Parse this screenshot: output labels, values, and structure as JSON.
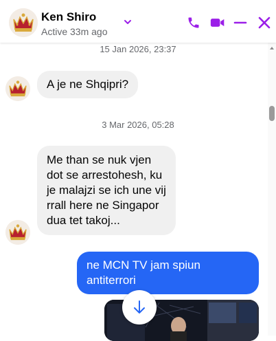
{
  "header": {
    "name": "Ken Shiro",
    "status": "Active 33m ago",
    "icons": [
      "chevron-down-icon",
      "phone-icon",
      "video-icon",
      "minimize-icon",
      "close-icon"
    ],
    "accent": "#9b1fe8"
  },
  "messages": [
    {
      "type": "timestamp",
      "text": "15 Jan 2026, 23:37"
    },
    {
      "type": "incoming",
      "text": "A je ne Shqipri?"
    },
    {
      "type": "timestamp",
      "text": "3 Mar 2026, 05:28"
    },
    {
      "type": "incoming",
      "lines": [
        "Me than se nuk vjen",
        "dot se arrestohesh, ku",
        "je malajzi se ich une vij",
        "rrall here ne Singapor",
        "dua tet takoj..."
      ]
    },
    {
      "type": "outgoing",
      "lines": [
        "ne MCN TV jam spiun",
        "antiterrori"
      ]
    },
    {
      "type": "outgoing-media",
      "icon": "video-thumbnail"
    }
  ],
  "colors": {
    "incoming_bubble": "#f0f0f0",
    "outgoing_bubble": "#2566f5",
    "timestamp": "#65676b"
  },
  "jump_button_icon": "arrow-down-icon"
}
